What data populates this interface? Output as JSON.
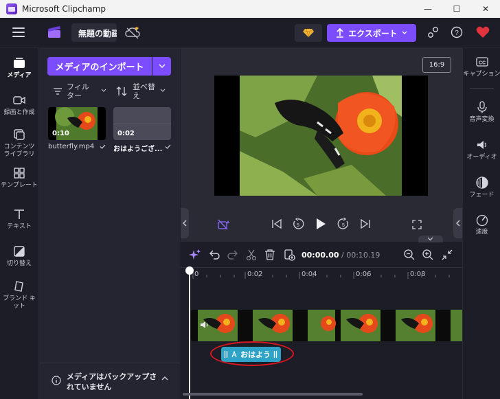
{
  "window": {
    "title": "Microsoft Clipchamp",
    "controls": {
      "minimize": "—",
      "maximize": "☐",
      "close": "✕"
    }
  },
  "header": {
    "project_name": "無題の動画",
    "export_label": "エクスポート"
  },
  "left_nav": {
    "items": [
      {
        "label": "メディア",
        "icon": "media-icon",
        "active": true
      },
      {
        "label": "録画と作成",
        "icon": "camera-icon"
      },
      {
        "label": "コンテンツ ライブラリ",
        "icon": "library-icon"
      },
      {
        "label": "テンプレート",
        "icon": "template-icon"
      },
      {
        "label": "テキスト",
        "icon": "text-icon"
      },
      {
        "label": "切り替え",
        "icon": "transition-icon"
      },
      {
        "label": "ブランド キット",
        "icon": "brand-kit-icon"
      }
    ]
  },
  "media_panel": {
    "import_label": "メディアのインポート",
    "filter_label": "フィルター",
    "sort_label": "並べ替え",
    "items": [
      {
        "name": "butterfly.mp4",
        "duration": "0:10"
      },
      {
        "name": "おはようござ...",
        "duration": "0:02"
      }
    ],
    "backup_notice": "メディアはバックアップされていません"
  },
  "preview": {
    "aspect_ratio": "16:9"
  },
  "right_rail": {
    "items": [
      {
        "label": "キャプション",
        "icon": "captions-icon"
      },
      {
        "label": "音声変換",
        "icon": "voice-icon"
      },
      {
        "label": "オーディオ",
        "icon": "audio-icon"
      },
      {
        "label": "フェード",
        "icon": "fade-icon"
      },
      {
        "label": "速度",
        "icon": "speed-icon"
      }
    ]
  },
  "timeline": {
    "current_time": "00:00.00",
    "total_time": "/ 00:10.19",
    "ruler_ticks": [
      "0",
      "0:02",
      "0:04",
      "0:06",
      "0:08"
    ],
    "text_clip_label": "おはよう",
    "text_clip_color": "#2fa3c7"
  },
  "colors": {
    "accent": "#7c4dff",
    "highlight_ring": "#d8181e"
  }
}
